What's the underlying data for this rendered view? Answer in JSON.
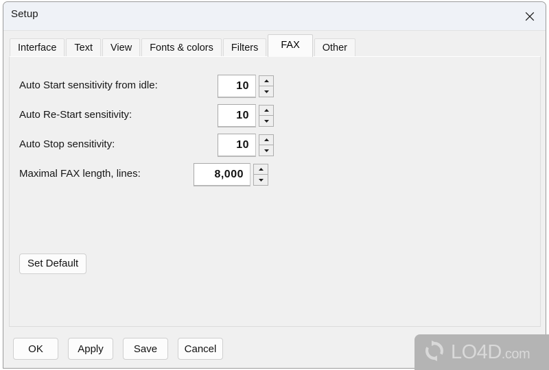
{
  "window": {
    "title": "Setup",
    "close_icon": "close-icon"
  },
  "tabs": [
    {
      "label": "Interface",
      "active": false
    },
    {
      "label": "Text",
      "active": false
    },
    {
      "label": "View",
      "active": false
    },
    {
      "label": "Fonts & colors",
      "active": false
    },
    {
      "label": "Filters",
      "active": false
    },
    {
      "label": "FAX",
      "active": true
    },
    {
      "label": "Other",
      "active": false
    }
  ],
  "form": {
    "rows": [
      {
        "label": "Auto Start sensitivity from idle:",
        "value": "10"
      },
      {
        "label": "Auto Re-Start sensitivity:",
        "value": "10"
      },
      {
        "label": "Auto Stop sensitivity:",
        "value": "10"
      },
      {
        "label": "Maximal FAX length, lines:",
        "value": "8,000"
      }
    ],
    "set_default_label": "Set Default"
  },
  "footer": {
    "buttons": [
      {
        "label": "OK"
      },
      {
        "label": "Apply"
      },
      {
        "label": "Save"
      },
      {
        "label": "Cancel"
      }
    ]
  },
  "watermark": {
    "name": "LO4D",
    "suffix": ".com",
    "icon": "refresh-arrows-icon",
    "color": "#b4b4b4"
  }
}
